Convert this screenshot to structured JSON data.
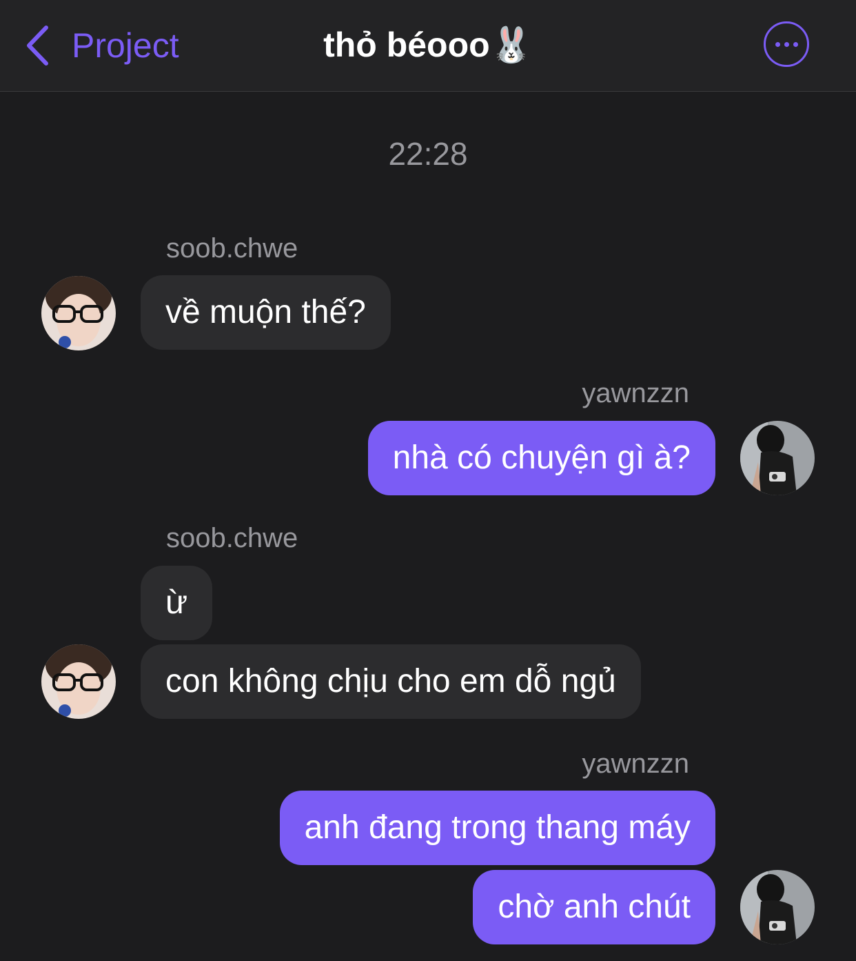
{
  "header": {
    "back_label": "Project",
    "title": "thỏ béooo🐰"
  },
  "timestamp": "22:28",
  "messages": [
    {
      "sender": "soob.chwe",
      "text": "về muộn thế?",
      "direction": "incoming"
    },
    {
      "sender": "yawnzzn",
      "text": "nhà có chuyện gì à?",
      "direction": "outgoing"
    },
    {
      "sender": "soob.chwe",
      "text": "ừ",
      "direction": "incoming"
    },
    {
      "text": "con không chịu cho em dỗ ngủ",
      "direction": "incoming"
    },
    {
      "sender": "yawnzzn",
      "text": "anh đang trong thang máy",
      "direction": "outgoing"
    },
    {
      "text": "chờ anh chút",
      "direction": "outgoing"
    }
  ],
  "colors": {
    "background": "#1c1c1e",
    "header": "#232325",
    "accent": "#7b5cf5",
    "incoming_bubble": "#2c2c2e",
    "muted_text": "#98989d"
  },
  "icons": [
    "chevron-left-icon",
    "more-options-icon",
    "user-avatar"
  ]
}
